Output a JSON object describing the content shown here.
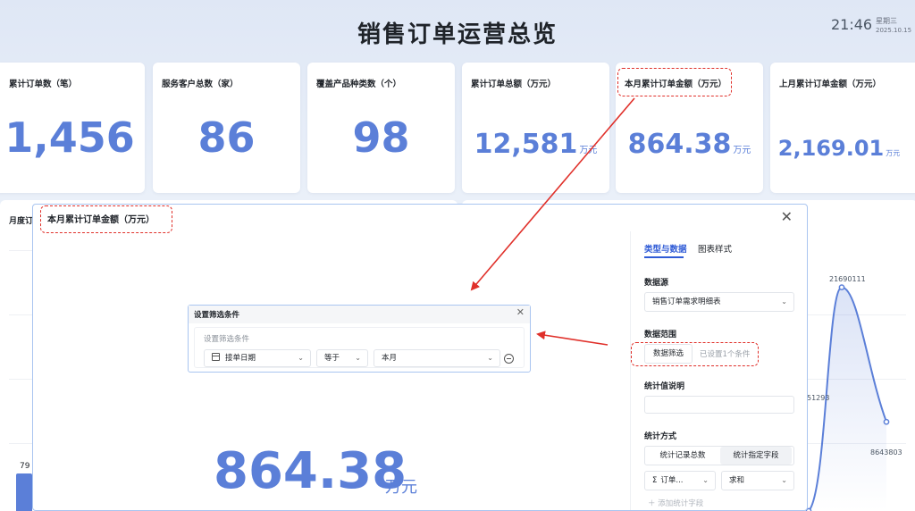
{
  "header": {
    "title": "销售订单运营总览",
    "time": "21:46",
    "weekday": "星期三",
    "date": "2025.10.15"
  },
  "kpis": [
    {
      "title": "累计订单数（笔）",
      "value": "1,456",
      "unit": ""
    },
    {
      "title": "服务客户总数（家）",
      "value": "86",
      "unit": ""
    },
    {
      "title": "覆盖产品种类数（个）",
      "value": "98",
      "unit": ""
    },
    {
      "title": "累计订单总额（万元）",
      "value": "12,581",
      "unit": "万元"
    },
    {
      "title": "本月累计订单金额（万元）",
      "value": "864.38",
      "unit": "万元"
    },
    {
      "title": "上月累计订单金额（万元）",
      "value": "2,169.01",
      "unit": "万元"
    }
  ],
  "background": {
    "panel_label": "月度订",
    "bar_value": "79"
  },
  "chart_data": {
    "type": "line",
    "labels": [
      "5129?",
      "21690111",
      "8643803"
    ],
    "values": [
      5129,
      21690111,
      8643803
    ],
    "visible_labels": [
      "51293",
      "21690111",
      "8643803"
    ]
  },
  "modal": {
    "title": "本月累计订单金额（万元）",
    "big_value": "864.38",
    "big_unit": "万元",
    "tabs": [
      "类型与数据",
      "图表样式"
    ],
    "data_source_label": "数据源",
    "data_source_value": "销售订单需求明细表",
    "data_range_label": "数据范围",
    "filter_button": "数据筛选",
    "filter_note": "已设置1个条件",
    "desc_label": "统计值说明",
    "method_label": "统计方式",
    "method_options": [
      "统计记录总数",
      "统计指定字段"
    ],
    "field_select": "订单...",
    "agg_select": "求和",
    "add_field": "添加统计字段"
  },
  "filter_dialog": {
    "title": "设置筛选条件",
    "sublabel": "设置筛选条件",
    "field": "接单日期",
    "operator": "等于",
    "value": "本月"
  },
  "colors": {
    "accent": "#5b7fd8",
    "annotation": "#e0302a",
    "tab_active": "#2f5bd6"
  }
}
